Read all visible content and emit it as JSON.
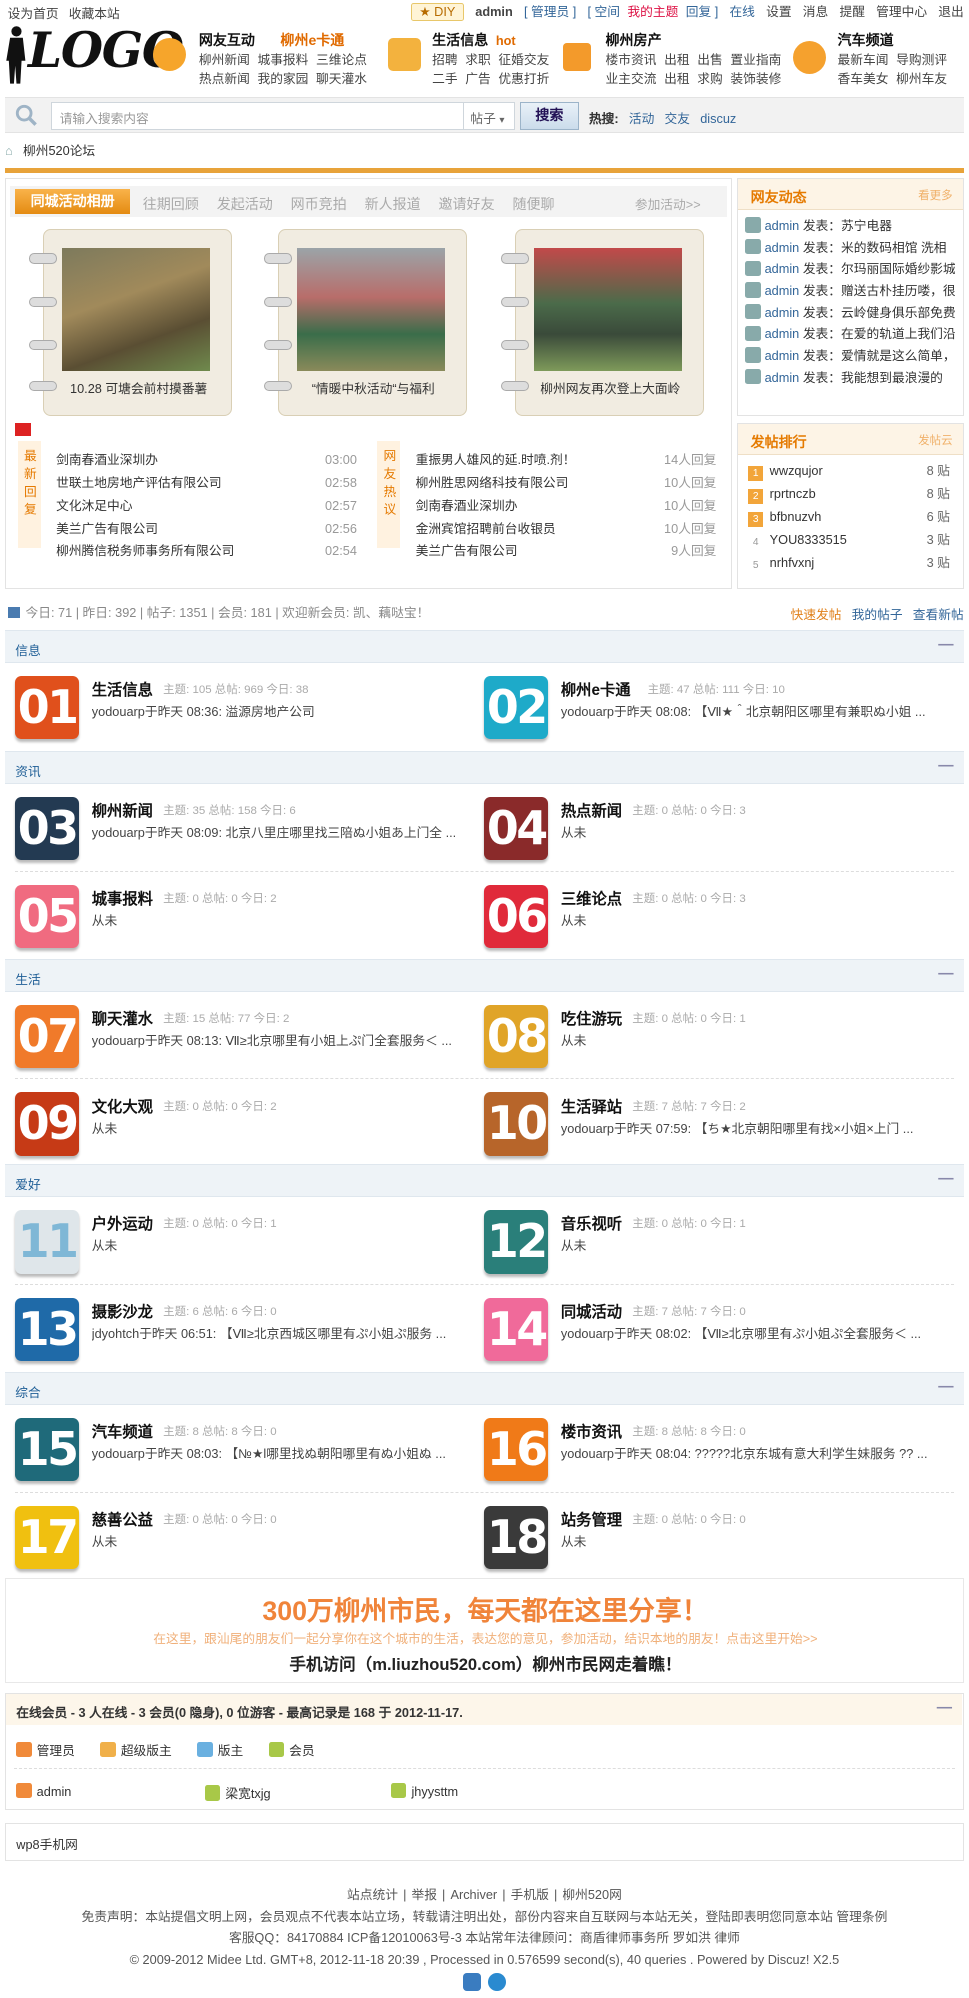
{
  "topbar": {
    "left": [
      "设为首页",
      "收藏本站"
    ],
    "diy": "DIY",
    "user": "admin",
    "role": "[ 管理员 ]",
    "links": [
      "[ 空间",
      "我的主题",
      "回复 ]",
      "在线",
      "设置",
      "消息",
      "提醒",
      "管理中心",
      "退出"
    ]
  },
  "logo": "LOGO",
  "nav": [
    {
      "title": "网友互动",
      "title2": "柳州e卡通",
      "rows": [
        [
          "柳州新闻",
          "城事报料",
          "三维论点"
        ],
        [
          "热点新闻",
          "我的家园",
          "聊天灌水"
        ]
      ]
    },
    {
      "title": "生活信息",
      "hot": "hot",
      "rows": [
        [
          "招聘",
          "求职",
          "征婚交友"
        ],
        [
          "二手",
          "广告",
          "优惠打折"
        ]
      ]
    },
    {
      "title": "柳州房产",
      "rows": [
        [
          "楼市资讯",
          "出租",
          "出售",
          "置业指南"
        ],
        [
          "业主交流",
          "出租",
          "求购",
          "装饰装修"
        ]
      ]
    },
    {
      "title": "汽车频道",
      "rows": [
        [
          "最新车闻",
          "导购测评"
        ],
        [
          "香车美女",
          "柳州车友"
        ]
      ]
    }
  ],
  "search": {
    "placeholder": "请输入搜索内容",
    "select": "帖子",
    "button": "搜索",
    "hot_label": "热搜:",
    "hot": [
      "活动",
      "交友",
      "discuz"
    ]
  },
  "breadcrumb": "柳州520论坛",
  "activity": {
    "tab_active": "同城活动相册",
    "tabs": [
      "往期回顾",
      "发起活动",
      "网币竞拍",
      "新人报道",
      "邀请好友",
      "随便聊"
    ],
    "more": "参加活动>>",
    "photos": [
      "10.28 可塘会前村摸番薯",
      "“情暖中秋活动“与福利",
      "柳州网友再次登上大面岭"
    ]
  },
  "latest": {
    "label": "最新回复",
    "items": [
      {
        "t": "剑南春酒业深圳办",
        "time": "03:00"
      },
      {
        "t": "世联土地房地产评估有限公司",
        "time": "02:58"
      },
      {
        "t": "文化沐足中心",
        "time": "02:57"
      },
      {
        "t": "美兰广告有限公司",
        "time": "02:56"
      },
      {
        "t": "柳州腾信税务师事务所有限公司",
        "time": "02:54"
      }
    ]
  },
  "hotlist": {
    "label": "网友热议",
    "items": [
      {
        "t": "重振男人雄风的延.时喷.剂！",
        "c": "14人回复"
      },
      {
        "t": "柳州胜思网络科技有限公司",
        "c": "10人回复"
      },
      {
        "t": "剑南春酒业深圳办",
        "c": "10人回复"
      },
      {
        "t": "金洲宾馆招聘前台收银员",
        "c": "10人回复"
      },
      {
        "t": "美兰广告有限公司",
        "c": "9人回复"
      }
    ]
  },
  "feed": {
    "title": "网友动态",
    "more": "看更多",
    "verb": "发表：",
    "items": [
      {
        "u": "admin",
        "t": "苏宁电器"
      },
      {
        "u": "admin",
        "t": "米的数码相馆 洗相"
      },
      {
        "u": "admin",
        "t": "尔玛丽国际婚纱影城"
      },
      {
        "u": "admin",
        "t": "赠送古朴挂历喽，很"
      },
      {
        "u": "admin",
        "t": "云岭健身俱乐部免费"
      },
      {
        "u": "admin",
        "t": "在爱的轨道上我们沿"
      },
      {
        "u": "admin",
        "t": "爱情就是这么简单，"
      },
      {
        "u": "admin",
        "t": "我能想到最浪漫的"
      }
    ]
  },
  "rank": {
    "title": "发帖排行",
    "more": "发帖云",
    "items": [
      {
        "n": "1",
        "u": "wwzqujor",
        "c": "8 贴"
      },
      {
        "n": "2",
        "u": "rprtnczb",
        "c": "8 贴"
      },
      {
        "n": "3",
        "u": "bfbnuzvh",
        "c": "6 贴"
      },
      {
        "n": "4",
        "u": "YOU8333515",
        "c": "3 贴"
      },
      {
        "n": "5",
        "u": "nrhfvxnj",
        "c": "3 贴"
      }
    ]
  },
  "stats": {
    "text": "今日: 71 | 昨日: 392 | 帖子: 1351 | 会员: 181 | 欢迎新会员: 凯、藕哒宝！",
    "links": [
      "快速发帖",
      "我的帖子",
      "查看新帖"
    ]
  },
  "sections": [
    {
      "name": "信息",
      "forums": [
        {
          "num": "01",
          "name": "生活信息",
          "stat": "主题: 105   总帖: 969   今日: 38",
          "last": "yodouarp于昨天 08:36: 溢源房地产公司"
        },
        {
          "num": "02",
          "name": "柳州e卡通",
          "stat": "主题: 47   总帖: 111   今日: 10",
          "last": "yodouarp于昨天 08:08: 【Ⅶ★＾北京朝阳区哪里有兼职ぬ小姐 ..."
        }
      ]
    },
    {
      "name": "资讯",
      "forums": [
        {
          "num": "03",
          "name": "柳州新闻",
          "stat": "主题: 35   总帖: 158   今日: 6",
          "last": "yodouarp于昨天 08:09: 北京八里庄哪里找三陪ぬ小姐あ上门全 ..."
        },
        {
          "num": "04",
          "name": "热点新闻",
          "stat": "主题: 0   总帖: 0   今日: 3",
          "last": "从未"
        },
        {
          "num": "05",
          "name": "城事报料",
          "stat": "主题: 0   总帖: 0   今日: 2",
          "last": "从未"
        },
        {
          "num": "06",
          "name": "三维论点",
          "stat": "主题: 0   总帖: 0   今日: 3",
          "last": "从未"
        }
      ]
    },
    {
      "name": "生活",
      "forums": [
        {
          "num": "07",
          "name": "聊天灌水",
          "stat": "主题: 15   总帖: 77   今日: 2",
          "last": "yodouarp于昨天 08:13: Ⅶ≥北京哪里有小姐上ぷ门全套服务＜ ..."
        },
        {
          "num": "08",
          "name": "吃住游玩",
          "stat": "主题: 0   总帖: 0   今日: 1",
          "last": "从未"
        },
        {
          "num": "09",
          "name": "文化大观",
          "stat": "主题: 0   总帖: 0   今日: 2",
          "last": "从未"
        },
        {
          "num": "10",
          "name": "生活驿站",
          "stat": "主题: 7   总帖: 7   今日: 2",
          "last": "yodouarp于昨天 07:59: 【ち★北京朝阳哪里有找×小姐×上门 ..."
        }
      ]
    },
    {
      "name": "爱好",
      "forums": [
        {
          "num": "11",
          "name": "户外运动",
          "stat": "主题: 0   总帖: 0   今日: 1",
          "last": "从未"
        },
        {
          "num": "12",
          "name": "音乐视听",
          "stat": "主题: 0   总帖: 0   今日: 1",
          "last": "从未"
        },
        {
          "num": "13",
          "name": "摄影沙龙",
          "stat": "主题: 6   总帖: 6   今日: 0",
          "last": "jdyohtch于昨天 06:51: 【Ⅶ≥北京西城区哪里有ぷ小姐ぷ服务 ..."
        },
        {
          "num": "14",
          "name": "同城活动",
          "stat": "主题: 7   总帖: 7   今日: 0",
          "last": "yodouarp于昨天 08:02: 【Ⅶ≥北京哪里有ぷ小姐ぷ全套服务＜ ..."
        }
      ]
    },
    {
      "name": "综合",
      "forums": [
        {
          "num": "15",
          "name": "汽车频道",
          "stat": "主题: 8   总帖: 8   今日: 0",
          "last": "yodouarp于昨天 08:03: 【№★l哪里找ぬ朝阳哪里有ぬ小姐ぬ ..."
        },
        {
          "num": "16",
          "name": "楼市资讯",
          "stat": "主题: 8   总帖: 8   今日: 0",
          "last": "yodouarp于昨天 08:04: ?????北京东城有意大利学生妹服务 ?? ..."
        },
        {
          "num": "17",
          "name": "慈善公益",
          "stat": "主题: 0   总帖: 0   今日: 0",
          "last": "从未"
        },
        {
          "num": "18",
          "name": "站务管理",
          "stat": "主题: 0   总帖: 0   今日: 0",
          "last": "从未"
        }
      ]
    }
  ],
  "colors": [
    "#e0501c",
    "#1eaac9",
    "#233a52",
    "#8a2a2a",
    "#f06b80",
    "#e02a3a",
    "#f07a2a",
    "#e0a428",
    "#c63a16",
    "#b7652a",
    "#dfe6ea",
    "#2a7f7a",
    "#1f6aa8",
    "#f06a9a",
    "#1f6a7a",
    "#f07a18",
    "#f0c010",
    "#3a3a3a"
  ],
  "banner": {
    "t1": "300万柳州市民，每天都在这里分享！",
    "t2": "在这里，跟汕尾的朋友们一起分享你在这个城市的生活，表达您的意见，参加活动，结识本地的朋友！点击这里开始>>",
    "t3": "手机访问（m.liuzhou520.com）柳州市民网走着瞧！"
  },
  "online": {
    "title": "在线会员 - 3 人在线 - 3 会员(0 隐身), 0 位游客 - 最高记录是 168 于 2012-11-17.",
    "legend": [
      "管理员",
      "超级版主",
      "版主",
      "会员"
    ],
    "users": [
      "admin",
      "梁宽txjg",
      "jhyysttm"
    ]
  },
  "links": "wp8手机网",
  "footer": {
    "l1": [
      "站点统计",
      "举报",
      "Archiver",
      "手机版",
      "柳州520网"
    ],
    "l2": "免责声明：本站提倡文明上网，会员观点不代表本站立场，转载请注明出处，部份内容来自互联网与本站无关，登陆即表明您同意本站 管理条例",
    "l3": "客服QQ：84170884 ICP备12010063号-3  本站常年法律顾问：商盾律师事务所 罗如洪 律师",
    "l4": "© 2009-2012 Midee Ltd. GMT+8, 2012-11-18 20:39 , Processed in 0.576599 second(s), 40 queries . Powered by Discuz! X2.5"
  }
}
